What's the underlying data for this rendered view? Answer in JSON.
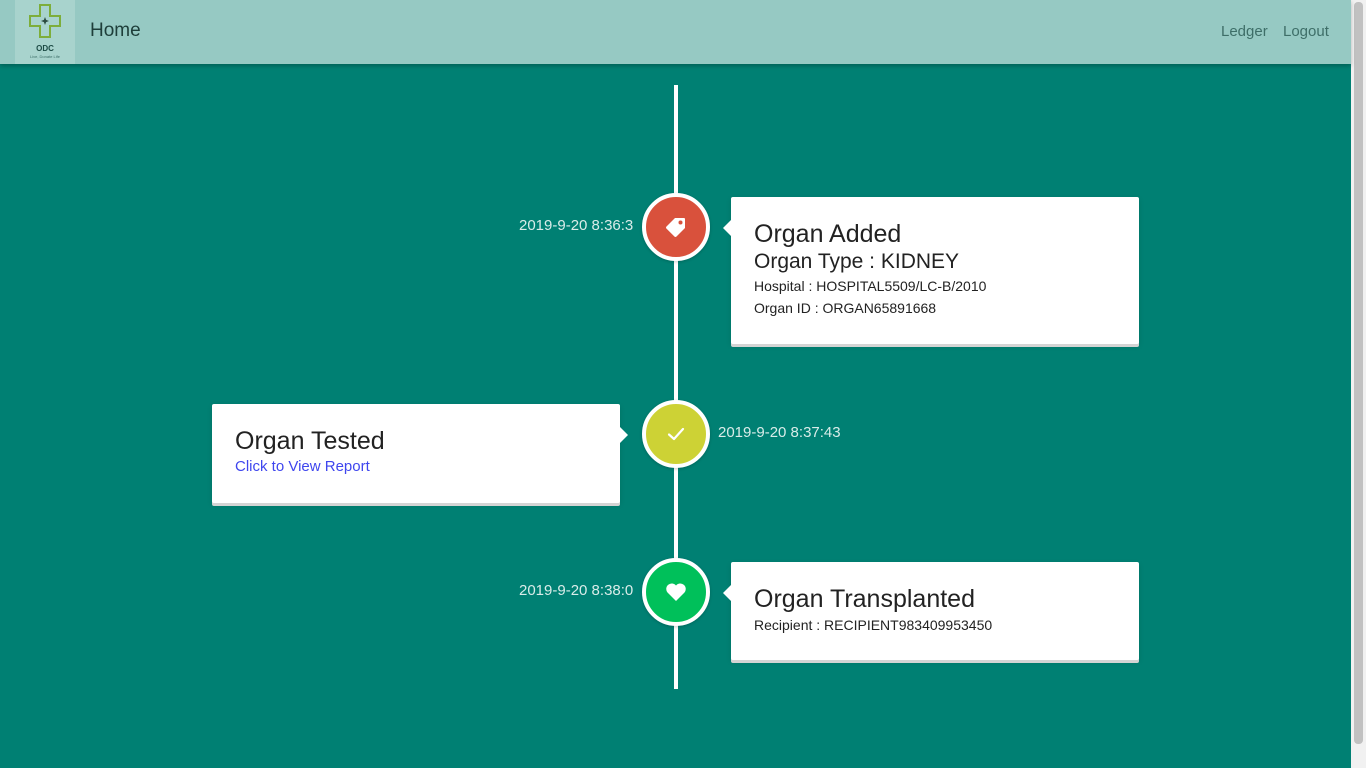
{
  "navbar": {
    "logo_text": "ODC",
    "logo_tagline": "Live, Donate Life",
    "brand": "Home",
    "links": {
      "ledger": "Ledger",
      "logout": "Logout"
    }
  },
  "timeline": {
    "events": [
      {
        "timestamp": "2019-9-20 8:36:3",
        "icon": "tag-icon",
        "color": "#d9513c",
        "title": "Organ Added",
        "subtitle": "Organ Type : KIDNEY",
        "hospital": "Hospital : HOSPITAL5509/LC-B/2010",
        "organ_id": "Organ ID : ORGAN65891668"
      },
      {
        "timestamp": "2019-9-20 8:37:43",
        "icon": "check-icon",
        "color": "#cdd235",
        "title": "Organ Tested",
        "link": "Click to View Report"
      },
      {
        "timestamp": "2019-9-20 8:38:0",
        "icon": "heart-icon",
        "color": "#00c05a",
        "title": "Organ Transplanted",
        "recipient": "Recipient : RECIPIENT983409953450"
      }
    ]
  }
}
